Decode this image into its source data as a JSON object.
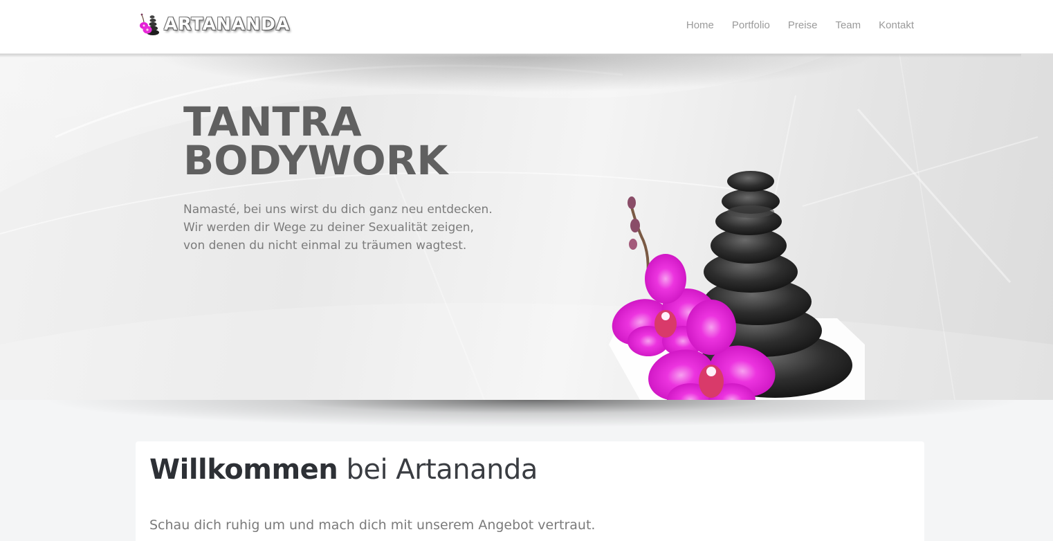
{
  "brand": {
    "name": "ARTANANDA",
    "logo_icon": "orchid-stones-icon"
  },
  "nav": {
    "items": [
      {
        "label": "Home"
      },
      {
        "label": "Portfolio"
      },
      {
        "label": "Preise"
      },
      {
        "label": "Team"
      },
      {
        "label": "Kontakt"
      }
    ]
  },
  "hero": {
    "title_line1": "TANTRA",
    "title_line2": "BODYWORK",
    "text_lines": [
      "Namasté, bei uns wirst du dich ganz neu entdecken.",
      "Wir werden dir Wege zu deiner Sexualität zeigen,",
      "von denen du nicht einmal zu träumen wagtest."
    ],
    "image": "orchid-and-stones-illustration"
  },
  "welcome": {
    "bold": "Willkommen",
    "light": " bei Artananda",
    "subline": "Schau dich ruhig um und mach dich mit unserem Angebot vertraut."
  },
  "colors": {
    "accent_magenta": "#e21fd6",
    "stone_dark": "#2a2a2a",
    "title_gray": "#606060",
    "nav_gray": "#9a9a9a"
  }
}
